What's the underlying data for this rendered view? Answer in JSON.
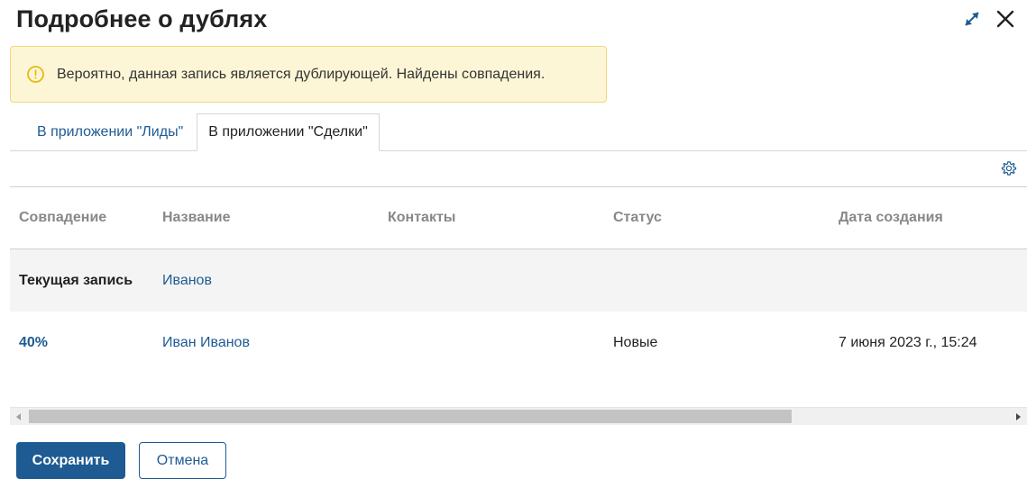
{
  "dialog": {
    "title": "Подробнее о дублях"
  },
  "alert": {
    "text": "Вероятно, данная запись является дублирующей. Найдены совпадения."
  },
  "tabs": [
    {
      "label": "В приложении \"Лиды\"",
      "active": false
    },
    {
      "label": "В приложении \"Сделки\"",
      "active": true
    }
  ],
  "table": {
    "columns": [
      "Совпадение",
      "Название",
      "Контакты",
      "Статус",
      "Дата создания"
    ],
    "current_row": {
      "match": "Текущая запись",
      "name": "Иванов",
      "contacts": "",
      "status": "",
      "created": ""
    },
    "rows": [
      {
        "match": "40%",
        "name": "Иван Иванов",
        "contacts": "",
        "status": "Новые",
        "created": "7 июня 2023 г., 15:24"
      }
    ]
  },
  "footer": {
    "save_label": "Сохранить",
    "cancel_label": "Отмена"
  },
  "colors": {
    "accent": "#1e5b93",
    "alert_bg": "#fdf6d6",
    "alert_border": "#f0d77b",
    "warning": "#e8b90f"
  },
  "icons": {
    "expand": "expand-icon",
    "close": "close-icon",
    "warning": "warning-icon",
    "settings": "gear-icon"
  }
}
